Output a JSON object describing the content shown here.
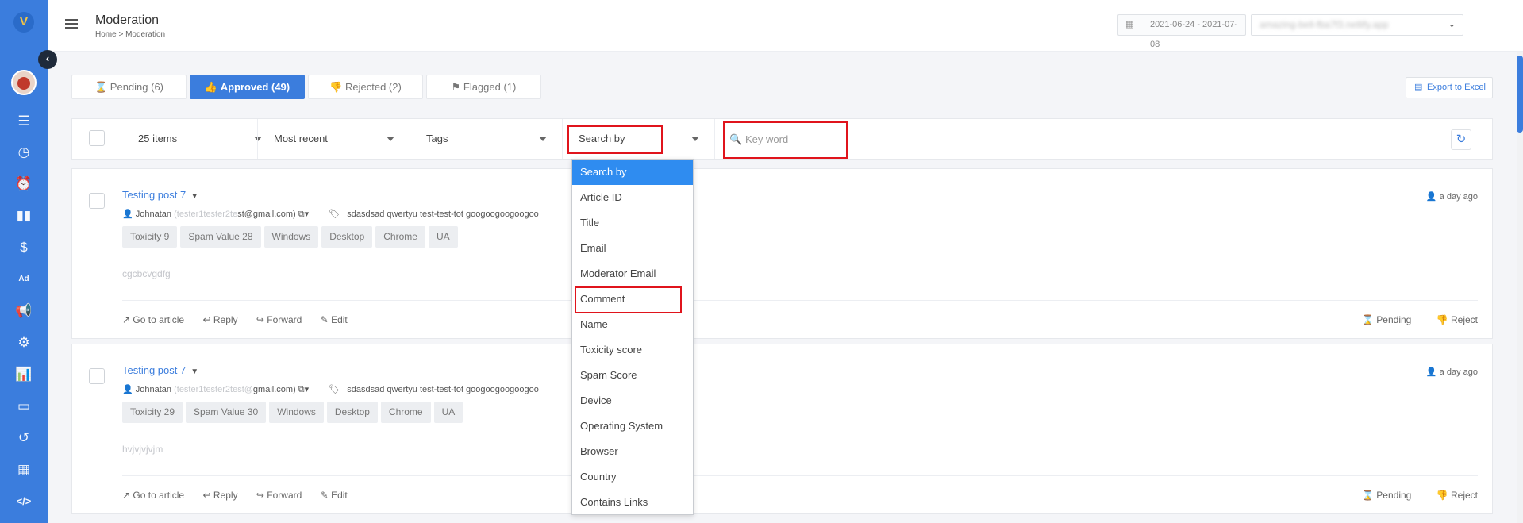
{
  "sidebar": {
    "logo_text": "V",
    "icons": [
      "list-icon",
      "clock-icon",
      "alarm-icon",
      "book-icon",
      "dollar-icon",
      "ad-icon",
      "megaphone-icon",
      "gear-icon",
      "analytics-icon",
      "card-icon",
      "history-icon",
      "table-icon",
      "code-icon"
    ],
    "active_icon": "megaphone-icon",
    "ad_text": "Ad"
  },
  "header": {
    "title": "Moderation",
    "breadcrumb": "Home  > Moderation",
    "date_range": "2021-06-24 - 2021-07-08",
    "site": "amazing-bell-fba7f3.netlify.app"
  },
  "tabs": [
    {
      "label": "Pending (6)",
      "icon": "hourglass-icon"
    },
    {
      "label": "Approved (49)",
      "icon": "thumbs-up-icon"
    },
    {
      "label": "Rejected (2)",
      "icon": "thumbs-down-icon"
    },
    {
      "label": "Flagged (1)",
      "icon": "flag-icon"
    }
  ],
  "export_label": "Export to Excel",
  "filters": {
    "items": "25 items",
    "sort": "Most recent",
    "tags": "Tags",
    "search_by": "Search by",
    "keyword_placeholder": "Key word"
  },
  "dropdown_options": [
    "Search by",
    "Article ID",
    "Title",
    "Email",
    "Moderator Email",
    "Comment",
    "Name",
    "Toxicity score",
    "Spam Score",
    "Device",
    "Operating System",
    "Browser",
    "Country",
    "Contains Links"
  ],
  "comments": [
    {
      "title": "Testing post 7",
      "author": "Johnatan",
      "email_prefix": "(tester1tester2te",
      "email_suffix": "st@gmail.com)",
      "tag_list": "sdasdsad   qwertyu test-test-tot   googoogoogoogoo",
      "tags": [
        "Toxicity 9",
        "Spam Value 28",
        "Windows",
        "Desktop",
        "Chrome",
        "UA"
      ],
      "text": "cgcbcvgdfg",
      "time": "a day ago"
    },
    {
      "title": "Testing post 7",
      "author": "Johnatan",
      "email_prefix": "(tester1tester2test@",
      "email_suffix": "gmail.com)",
      "tag_list": "sdasdsad   qwertyu test-test-tot   googoogoogoogoo",
      "tags": [
        "Toxicity 29",
        "Spam Value 30",
        "Windows",
        "Desktop",
        "Chrome",
        "UA"
      ],
      "text": "hvjvjvjvjm",
      "time": "a day ago"
    }
  ],
  "actions": {
    "go_to_article": "Go to article",
    "reply": "Reply",
    "forward": "Forward",
    "edit": "Edit",
    "pending": "Pending",
    "reject": "Reject"
  },
  "colors": {
    "primary": "#3b7ddd",
    "highlight_box": "#e0141c",
    "selected_option": "#2f8cf0"
  }
}
